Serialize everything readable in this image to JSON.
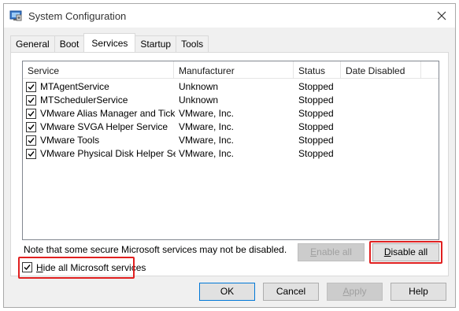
{
  "window": {
    "title": "System Configuration"
  },
  "tabs": [
    {
      "label": "General",
      "active": false
    },
    {
      "label": "Boot",
      "active": false
    },
    {
      "label": "Services",
      "active": true
    },
    {
      "label": "Startup",
      "active": false
    },
    {
      "label": "Tools",
      "active": false
    }
  ],
  "services_table": {
    "columns": [
      "Service",
      "Manufacturer",
      "Status",
      "Date Disabled"
    ],
    "rows": [
      {
        "checked": true,
        "service": "MTAgentService",
        "manufacturer": "Unknown",
        "status": "Stopped",
        "date_disabled": ""
      },
      {
        "checked": true,
        "service": "MTSchedulerService",
        "manufacturer": "Unknown",
        "status": "Stopped",
        "date_disabled": ""
      },
      {
        "checked": true,
        "service": "VMware Alias Manager and Ticke...",
        "manufacturer": "VMware, Inc.",
        "status": "Stopped",
        "date_disabled": ""
      },
      {
        "checked": true,
        "service": "VMware SVGA Helper Service",
        "manufacturer": "VMware, Inc.",
        "status": "Stopped",
        "date_disabled": ""
      },
      {
        "checked": true,
        "service": "VMware Tools",
        "manufacturer": "VMware, Inc.",
        "status": "Stopped",
        "date_disabled": ""
      },
      {
        "checked": true,
        "service": "VMware Physical Disk Helper Ser...",
        "manufacturer": "VMware, Inc.",
        "status": "Stopped",
        "date_disabled": ""
      }
    ]
  },
  "note": "Note that some secure Microsoft services may not be disabled.",
  "buttons": {
    "enable_all": {
      "pre": "",
      "hotkey": "E",
      "post": "nable all",
      "disabled": true
    },
    "disable_all": {
      "pre": "",
      "hotkey": "D",
      "post": "isable all",
      "disabled": false
    },
    "ok": "OK",
    "cancel": "Cancel",
    "apply": {
      "pre": "",
      "hotkey": "A",
      "post": "pply",
      "disabled": true
    },
    "help": "Help"
  },
  "hide_ms": {
    "checked": true,
    "pre": "",
    "hotkey": "H",
    "post": "ide all Microsoft services"
  },
  "colors": {
    "highlight": "#e02020",
    "default_button_border": "#0078d7",
    "disabled_text": "#a0a0a0"
  }
}
